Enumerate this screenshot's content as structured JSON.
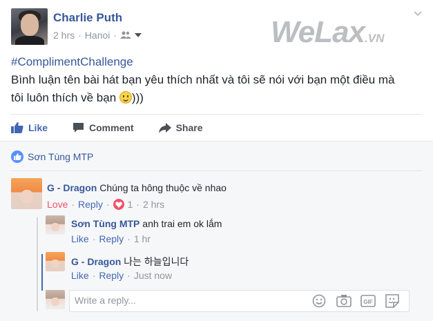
{
  "post": {
    "author": "Charlie Puth",
    "time": "2 hrs",
    "location": "Hanoi",
    "hashtag": "#ComplimentChallenge",
    "text_line1": "Bình luận tên bài hát bạn yêu thích nhất và tôi sẽ nói với bạn một điều mà",
    "text_line2": "tôi luôn thích về bạn",
    "text_end": ")))"
  },
  "watermark": {
    "main": "WeLax",
    "suffix": ".VN"
  },
  "actions": {
    "like": "Like",
    "comment": "Comment",
    "share": "Share"
  },
  "likers": {
    "name": "Sơn Tùng MTP"
  },
  "comments": [
    {
      "author": "G - Dragon",
      "text": "Chúng ta hông thuộc về nhao",
      "reaction": "Love",
      "reply": "Reply",
      "count": "1",
      "time": "2 hrs",
      "replies": [
        {
          "author": "Sơn Tùng MTP",
          "text": "anh trai em ok lắm",
          "like": "Like",
          "reply": "Reply",
          "time": "1 hr"
        },
        {
          "author": "G - Dragon",
          "text": "나는 하늘입니다",
          "like": "Like",
          "reply": "Reply",
          "time": "Just now"
        }
      ]
    }
  ],
  "reply_box": {
    "placeholder": "Write a reply..."
  },
  "colors": {
    "link": "#365899",
    "accent": "#4267b2",
    "love": "#f25268",
    "meta": "#90949c"
  },
  "icons": [
    "like-thumb-icon",
    "comment-bubble-icon",
    "share-arrow-icon",
    "friends-icon",
    "emoji-icon",
    "camera-icon",
    "gif-icon",
    "sticker-icon"
  ]
}
